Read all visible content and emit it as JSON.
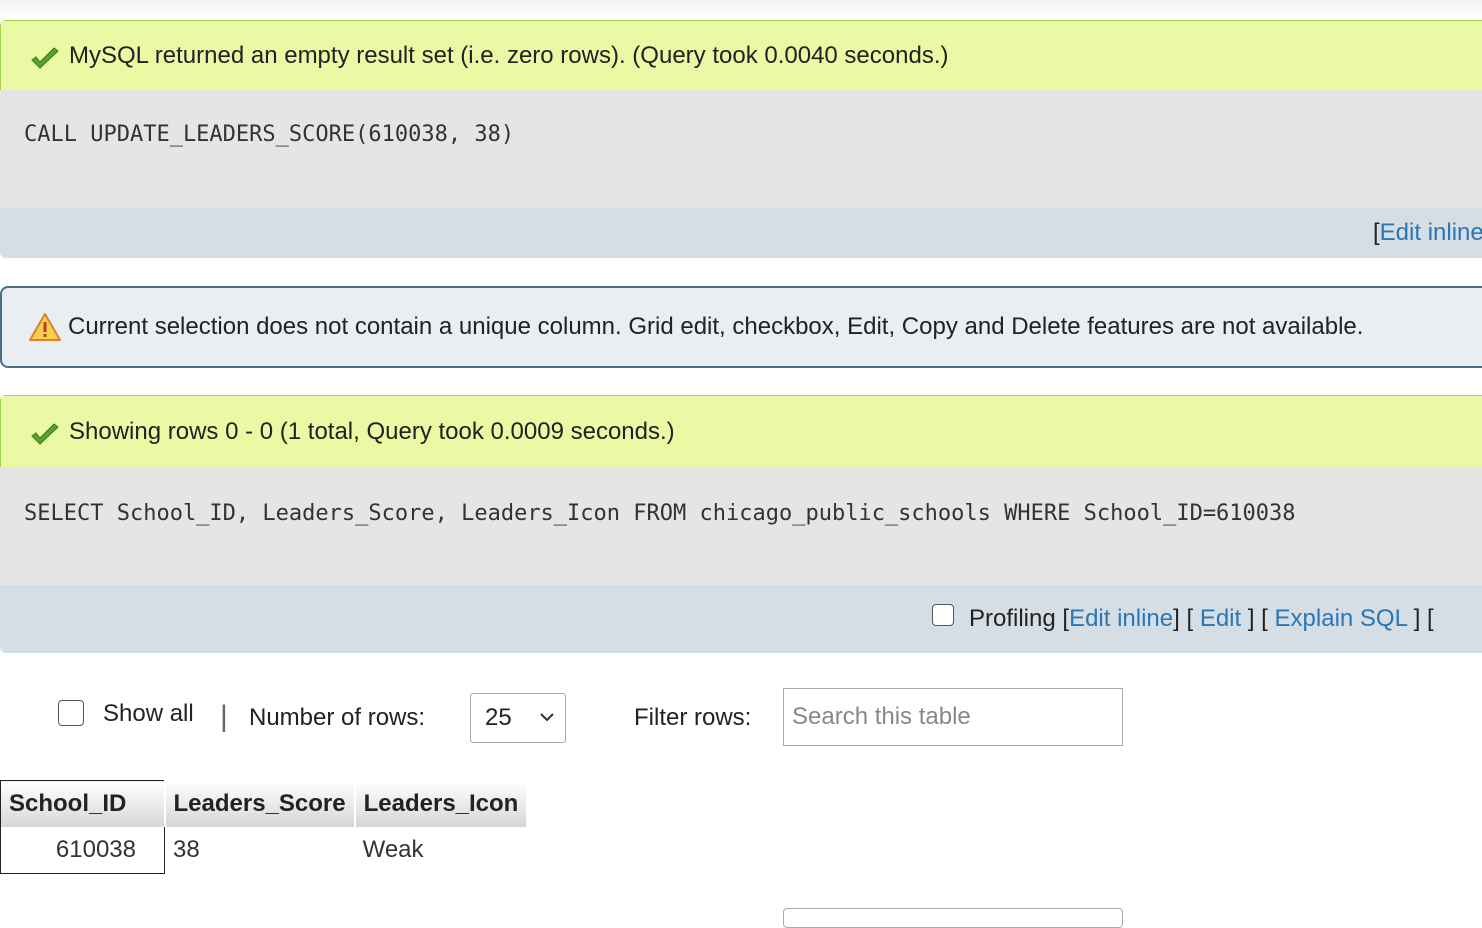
{
  "query1": {
    "message": "MySQL returned an empty result set (i.e. zero rows). (Query took 0.0040 seconds.)",
    "sql": "CALL UPDATE_LEADERS_SCORE(610038, 38)",
    "edit_inline_label": "Edit inline",
    "bracket_open": "["
  },
  "notice": {
    "message": "Current selection does not contain a unique column. Grid edit, checkbox, Edit, Copy and Delete features are not available."
  },
  "query2": {
    "message": "Showing rows 0 - 0 (1 total, Query took 0.0009 seconds.)",
    "sql": "SELECT School_ID, Leaders_Score, Leaders_Icon FROM chicago_public_schools WHERE School_ID=610038",
    "profiling_label": "Profiling",
    "edit_inline_label": "Edit inline",
    "edit_label": "Edit",
    "explain_label": "Explain SQL",
    "sep1": "[",
    "sep2": "] [",
    "sep3": "] [",
    "sep4": "] ["
  },
  "controls": {
    "show_all_label": "Show all",
    "divider": "|",
    "rows_label": "Number of rows:",
    "rows_value": "25",
    "filter_label": "Filter rows:",
    "filter_placeholder": "Search this table"
  },
  "table": {
    "columns": [
      "School_ID",
      "Leaders_Score",
      "Leaders_Icon"
    ],
    "rows": [
      [
        "610038",
        "38",
        "Weak"
      ]
    ]
  },
  "colors": {
    "success_bg": "#ebf8a4",
    "sql_bg": "#e5e5e5",
    "tools_bg": "#d5dde5",
    "notice_bg": "#e8eef1",
    "link": "#2b77b5"
  }
}
